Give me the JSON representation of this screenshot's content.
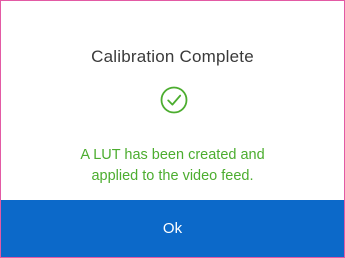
{
  "dialog": {
    "title": "Calibration Complete",
    "icon": "check-circle-icon",
    "message_lines": [
      "A LUT has been created and",
      "applied to the video feed."
    ],
    "ok_label": "Ok"
  },
  "colors": {
    "border": "#e35aa4",
    "title": "#3a3a3a",
    "success": "#4cad2f",
    "button": "#0c69c9",
    "button_text": "#ffffff"
  }
}
